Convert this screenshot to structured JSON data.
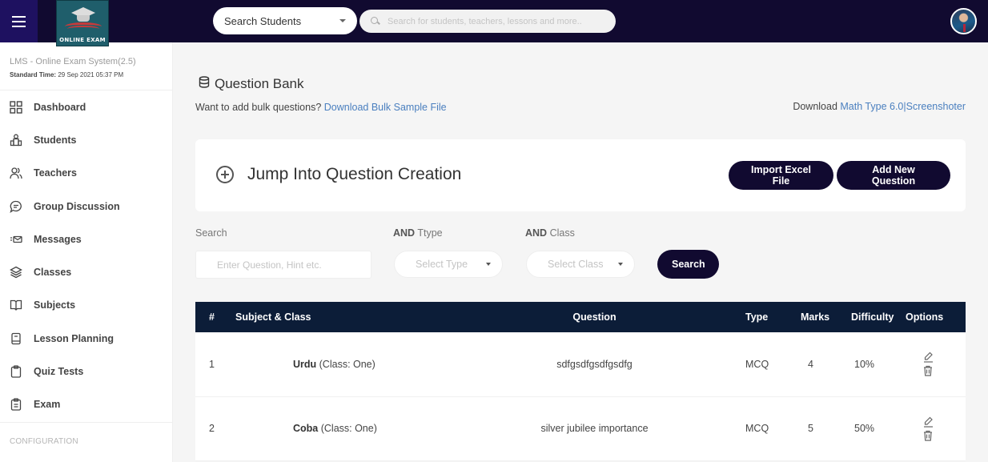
{
  "header": {
    "menu_icon": "hamburger-icon",
    "logo_text": "ONLINE EXAM",
    "search_scope": "Search Students",
    "global_search_placeholder": "Search for students, teachers, lessons and more..",
    "avatar_icon": "user-avatar"
  },
  "sidebar": {
    "app_name": "LMS - Online Exam System(2.5)",
    "time_label": "Standard Time:",
    "time_value": "29 Sep 2021 05:37 PM",
    "items": [
      {
        "label": "Dashboard",
        "icon": "dashboard-grid-icon"
      },
      {
        "label": "Students",
        "icon": "students-icon"
      },
      {
        "label": "Teachers",
        "icon": "teachers-icon"
      },
      {
        "label": "Group Discussion",
        "icon": "chat-bubble-icon"
      },
      {
        "label": "Messages",
        "icon": "envelope-icon"
      },
      {
        "label": "Classes",
        "icon": "layers-icon"
      },
      {
        "label": "Subjects",
        "icon": "book-open-icon"
      },
      {
        "label": "Lesson Planning",
        "icon": "notebook-icon"
      },
      {
        "label": "Quiz Tests",
        "icon": "clipboard-icon"
      },
      {
        "label": "Exam",
        "icon": "clipboard-list-icon"
      }
    ],
    "section_label": "CONFIGURATION"
  },
  "page": {
    "title": "Question Bank",
    "title_icon": "database-icon",
    "bulk_prompt": "Want to add bulk questions?",
    "bulk_link": "Download Bulk Sample File",
    "download_prefix": "Download",
    "math_link": "Math Type 6.0",
    "screenshoter_link": "|Screenshoter"
  },
  "jump": {
    "title": "Jump Into Question Creation",
    "icon": "plus-circle-icon",
    "import_label": "Import Excel File",
    "add_label": "Add New Question"
  },
  "filters": {
    "search_label": "Search",
    "search_placeholder": "Enter Question, Hint etc.",
    "search_value": "",
    "type_label_bold": "AND",
    "type_label": " Ttype",
    "type_placeholder": "Select Type",
    "class_label_bold": "AND",
    "class_label": " Class",
    "class_placeholder": "Select Class",
    "search_button": "Search"
  },
  "table": {
    "columns": [
      "#",
      "Subject & Class",
      "Question",
      "Type",
      "Marks",
      "Difficulty",
      "Options"
    ],
    "rows": [
      {
        "num": "1",
        "subject": "Urdu",
        "class": " (Class: One)",
        "question": "sdfgsdfgsdfgsdfg",
        "type": "MCQ",
        "marks": "4",
        "difficulty": "10%"
      },
      {
        "num": "2",
        "subject": "Coba",
        "class": " (Class: One)",
        "question": "silver jubilee importance",
        "type": "MCQ",
        "marks": "5",
        "difficulty": "50%"
      }
    ]
  },
  "colors": {
    "topbar": "#110a30",
    "table_header": "#0c1d38",
    "link": "#4a7fbf",
    "button": "#110a30"
  }
}
